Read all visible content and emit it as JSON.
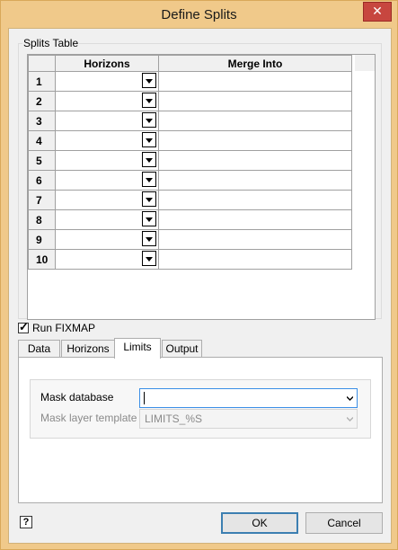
{
  "window": {
    "title": "Define Splits",
    "close_glyph": "✕"
  },
  "splits_table": {
    "group_label": "Splits Table",
    "columns": [
      "Horizons",
      "Merge Into"
    ],
    "rows": [
      {
        "num": "1",
        "horizon": "",
        "merge_into": ""
      },
      {
        "num": "2",
        "horizon": "",
        "merge_into": ""
      },
      {
        "num": "3",
        "horizon": "",
        "merge_into": ""
      },
      {
        "num": "4",
        "horizon": "",
        "merge_into": ""
      },
      {
        "num": "5",
        "horizon": "",
        "merge_into": ""
      },
      {
        "num": "6",
        "horizon": "",
        "merge_into": ""
      },
      {
        "num": "7",
        "horizon": "",
        "merge_into": ""
      },
      {
        "num": "8",
        "horizon": "",
        "merge_into": ""
      },
      {
        "num": "9",
        "horizon": "",
        "merge_into": ""
      },
      {
        "num": "10",
        "horizon": "",
        "merge_into": ""
      }
    ]
  },
  "run_fixmap": {
    "label": "Run FIXMAP",
    "checked": true
  },
  "tabs": [
    {
      "label": "Data",
      "active": false
    },
    {
      "label": "Horizons",
      "active": false
    },
    {
      "label": "Limits",
      "active": true
    },
    {
      "label": "Output",
      "active": false
    }
  ],
  "limits": {
    "mask_database_label": "Mask database",
    "mask_database_value": "",
    "mask_layer_label": "Mask layer template",
    "mask_layer_value": "LIMITS_%S",
    "mask_layer_disabled": true
  },
  "footer": {
    "help_glyph": "?",
    "ok_label": "OK",
    "cancel_label": "Cancel"
  },
  "colors": {
    "title_bar": "#f0c98a",
    "close_button": "#c7463f",
    "focus_border": "#3a8ee6",
    "default_button_border": "#3c7fb1"
  }
}
